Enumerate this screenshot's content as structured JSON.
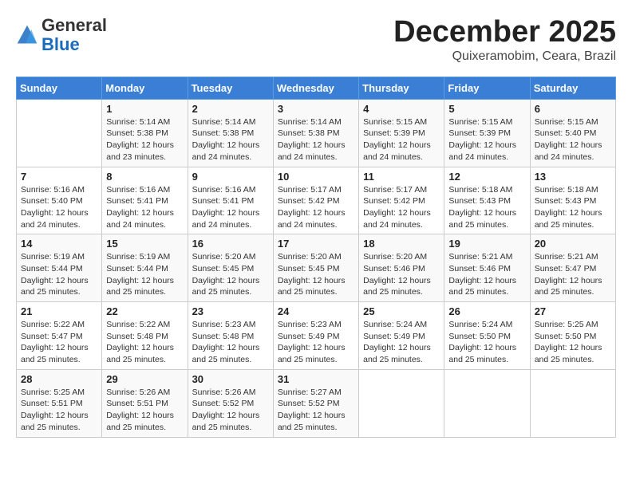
{
  "header": {
    "logo_line1": "General",
    "logo_line2": "Blue",
    "month": "December 2025",
    "location": "Quixeramobim, Ceara, Brazil"
  },
  "days_of_week": [
    "Sunday",
    "Monday",
    "Tuesday",
    "Wednesday",
    "Thursday",
    "Friday",
    "Saturday"
  ],
  "weeks": [
    [
      {
        "day": "",
        "sunrise": "",
        "sunset": "",
        "daylight": ""
      },
      {
        "day": "1",
        "sunrise": "Sunrise: 5:14 AM",
        "sunset": "Sunset: 5:38 PM",
        "daylight": "Daylight: 12 hours and 23 minutes."
      },
      {
        "day": "2",
        "sunrise": "Sunrise: 5:14 AM",
        "sunset": "Sunset: 5:38 PM",
        "daylight": "Daylight: 12 hours and 24 minutes."
      },
      {
        "day": "3",
        "sunrise": "Sunrise: 5:14 AM",
        "sunset": "Sunset: 5:38 PM",
        "daylight": "Daylight: 12 hours and 24 minutes."
      },
      {
        "day": "4",
        "sunrise": "Sunrise: 5:15 AM",
        "sunset": "Sunset: 5:39 PM",
        "daylight": "Daylight: 12 hours and 24 minutes."
      },
      {
        "day": "5",
        "sunrise": "Sunrise: 5:15 AM",
        "sunset": "Sunset: 5:39 PM",
        "daylight": "Daylight: 12 hours and 24 minutes."
      },
      {
        "day": "6",
        "sunrise": "Sunrise: 5:15 AM",
        "sunset": "Sunset: 5:40 PM",
        "daylight": "Daylight: 12 hours and 24 minutes."
      }
    ],
    [
      {
        "day": "7",
        "sunrise": "Sunrise: 5:16 AM",
        "sunset": "Sunset: 5:40 PM",
        "daylight": "Daylight: 12 hours and 24 minutes."
      },
      {
        "day": "8",
        "sunrise": "Sunrise: 5:16 AM",
        "sunset": "Sunset: 5:41 PM",
        "daylight": "Daylight: 12 hours and 24 minutes."
      },
      {
        "day": "9",
        "sunrise": "Sunrise: 5:16 AM",
        "sunset": "Sunset: 5:41 PM",
        "daylight": "Daylight: 12 hours and 24 minutes."
      },
      {
        "day": "10",
        "sunrise": "Sunrise: 5:17 AM",
        "sunset": "Sunset: 5:42 PM",
        "daylight": "Daylight: 12 hours and 24 minutes."
      },
      {
        "day": "11",
        "sunrise": "Sunrise: 5:17 AM",
        "sunset": "Sunset: 5:42 PM",
        "daylight": "Daylight: 12 hours and 24 minutes."
      },
      {
        "day": "12",
        "sunrise": "Sunrise: 5:18 AM",
        "sunset": "Sunset: 5:43 PM",
        "daylight": "Daylight: 12 hours and 25 minutes."
      },
      {
        "day": "13",
        "sunrise": "Sunrise: 5:18 AM",
        "sunset": "Sunset: 5:43 PM",
        "daylight": "Daylight: 12 hours and 25 minutes."
      }
    ],
    [
      {
        "day": "14",
        "sunrise": "Sunrise: 5:19 AM",
        "sunset": "Sunset: 5:44 PM",
        "daylight": "Daylight: 12 hours and 25 minutes."
      },
      {
        "day": "15",
        "sunrise": "Sunrise: 5:19 AM",
        "sunset": "Sunset: 5:44 PM",
        "daylight": "Daylight: 12 hours and 25 minutes."
      },
      {
        "day": "16",
        "sunrise": "Sunrise: 5:20 AM",
        "sunset": "Sunset: 5:45 PM",
        "daylight": "Daylight: 12 hours and 25 minutes."
      },
      {
        "day": "17",
        "sunrise": "Sunrise: 5:20 AM",
        "sunset": "Sunset: 5:45 PM",
        "daylight": "Daylight: 12 hours and 25 minutes."
      },
      {
        "day": "18",
        "sunrise": "Sunrise: 5:20 AM",
        "sunset": "Sunset: 5:46 PM",
        "daylight": "Daylight: 12 hours and 25 minutes."
      },
      {
        "day": "19",
        "sunrise": "Sunrise: 5:21 AM",
        "sunset": "Sunset: 5:46 PM",
        "daylight": "Daylight: 12 hours and 25 minutes."
      },
      {
        "day": "20",
        "sunrise": "Sunrise: 5:21 AM",
        "sunset": "Sunset: 5:47 PM",
        "daylight": "Daylight: 12 hours and 25 minutes."
      }
    ],
    [
      {
        "day": "21",
        "sunrise": "Sunrise: 5:22 AM",
        "sunset": "Sunset: 5:47 PM",
        "daylight": "Daylight: 12 hours and 25 minutes."
      },
      {
        "day": "22",
        "sunrise": "Sunrise: 5:22 AM",
        "sunset": "Sunset: 5:48 PM",
        "daylight": "Daylight: 12 hours and 25 minutes."
      },
      {
        "day": "23",
        "sunrise": "Sunrise: 5:23 AM",
        "sunset": "Sunset: 5:48 PM",
        "daylight": "Daylight: 12 hours and 25 minutes."
      },
      {
        "day": "24",
        "sunrise": "Sunrise: 5:23 AM",
        "sunset": "Sunset: 5:49 PM",
        "daylight": "Daylight: 12 hours and 25 minutes."
      },
      {
        "day": "25",
        "sunrise": "Sunrise: 5:24 AM",
        "sunset": "Sunset: 5:49 PM",
        "daylight": "Daylight: 12 hours and 25 minutes."
      },
      {
        "day": "26",
        "sunrise": "Sunrise: 5:24 AM",
        "sunset": "Sunset: 5:50 PM",
        "daylight": "Daylight: 12 hours and 25 minutes."
      },
      {
        "day": "27",
        "sunrise": "Sunrise: 5:25 AM",
        "sunset": "Sunset: 5:50 PM",
        "daylight": "Daylight: 12 hours and 25 minutes."
      }
    ],
    [
      {
        "day": "28",
        "sunrise": "Sunrise: 5:25 AM",
        "sunset": "Sunset: 5:51 PM",
        "daylight": "Daylight: 12 hours and 25 minutes."
      },
      {
        "day": "29",
        "sunrise": "Sunrise: 5:26 AM",
        "sunset": "Sunset: 5:51 PM",
        "daylight": "Daylight: 12 hours and 25 minutes."
      },
      {
        "day": "30",
        "sunrise": "Sunrise: 5:26 AM",
        "sunset": "Sunset: 5:52 PM",
        "daylight": "Daylight: 12 hours and 25 minutes."
      },
      {
        "day": "31",
        "sunrise": "Sunrise: 5:27 AM",
        "sunset": "Sunset: 5:52 PM",
        "daylight": "Daylight: 12 hours and 25 minutes."
      },
      {
        "day": "",
        "sunrise": "",
        "sunset": "",
        "daylight": ""
      },
      {
        "day": "",
        "sunrise": "",
        "sunset": "",
        "daylight": ""
      },
      {
        "day": "",
        "sunrise": "",
        "sunset": "",
        "daylight": ""
      }
    ]
  ]
}
